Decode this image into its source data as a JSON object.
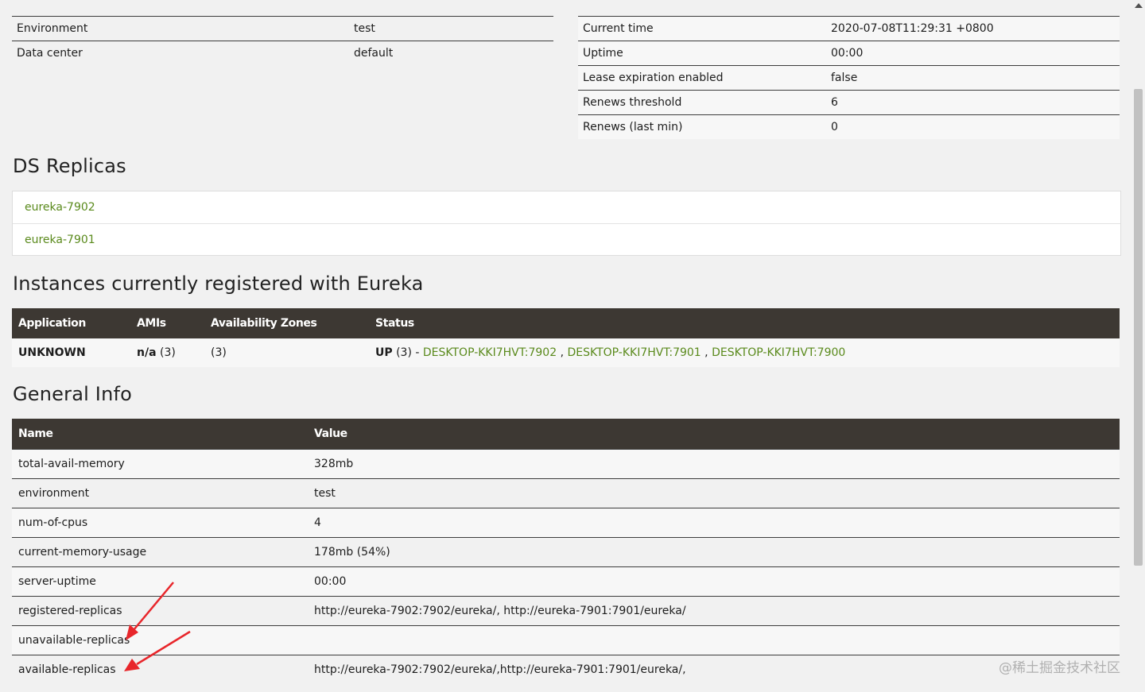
{
  "system_status_left": [
    {
      "label": "Environment",
      "value": "test"
    },
    {
      "label": "Data center",
      "value": "default"
    }
  ],
  "system_status_right": [
    {
      "label": "Current time",
      "value": "2020-07-08T11:29:31 +0800"
    },
    {
      "label": "Uptime",
      "value": "00:00"
    },
    {
      "label": "Lease expiration enabled",
      "value": "false"
    },
    {
      "label": "Renews threshold",
      "value": "6"
    },
    {
      "label": "Renews (last min)",
      "value": "0"
    }
  ],
  "ds_replicas": {
    "title": "DS Replicas",
    "items": [
      "eureka-7902",
      "eureka-7901"
    ]
  },
  "instances": {
    "title": "Instances currently registered with Eureka",
    "headers": [
      "Application",
      "AMIs",
      "Availability Zones",
      "Status"
    ],
    "row": {
      "application": "UNKNOWN",
      "amis_label": "n/a",
      "amis_count": "(3)",
      "zones": "(3)",
      "status_label": "UP",
      "status_count": "(3) -",
      "links": [
        "DESKTOP-KKI7HVT:7902",
        "DESKTOP-KKI7HVT:7901",
        "DESKTOP-KKI7HVT:7900"
      ],
      "separator": ","
    }
  },
  "general_info": {
    "title": "General Info",
    "headers": [
      "Name",
      "Value"
    ],
    "rows": [
      {
        "name": "total-avail-memory",
        "value": "328mb"
      },
      {
        "name": "environment",
        "value": "test"
      },
      {
        "name": "num-of-cpus",
        "value": "4"
      },
      {
        "name": "current-memory-usage",
        "value": "178mb (54%)"
      },
      {
        "name": "server-uptime",
        "value": "00:00"
      },
      {
        "name": "registered-replicas",
        "value": "http://eureka-7902:7902/eureka/, http://eureka-7901:7901/eureka/"
      },
      {
        "name": "unavailable-replicas",
        "value": ""
      },
      {
        "name": "available-replicas",
        "value": "http://eureka-7902:7902/eureka/,http://eureka-7901:7901/eureka/,"
      }
    ]
  },
  "watermark": "@稀土掘金技术社区",
  "colors": {
    "link": "#5a8a1c",
    "header_bg": "#3d3833",
    "annotation_arrow": "#e8262b"
  },
  "icons": [
    "arrow-annotation-icon",
    "scroll-up-icon"
  ]
}
